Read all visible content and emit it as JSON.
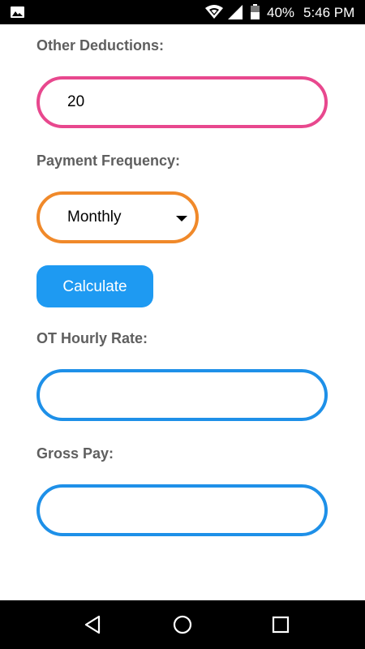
{
  "status_bar": {
    "battery": "40%",
    "time": "5:46 PM"
  },
  "form": {
    "other_deductions": {
      "label": "Other Deductions:",
      "value": "20"
    },
    "payment_frequency": {
      "label": "Payment Frequency:",
      "selected": "Monthly"
    },
    "calculate_label": "Calculate",
    "ot_hourly_rate": {
      "label": "OT Hourly Rate:",
      "value": ""
    },
    "gross_pay": {
      "label": "Gross Pay:",
      "value": ""
    }
  },
  "colors": {
    "deductions_border": "#e8488e",
    "frequency_border": "#f0892a",
    "output_border": "#1e90e8",
    "button_bg": "#1e9af2",
    "label_text": "#5f5f5f"
  },
  "icons": {
    "status_left": "image-gallery-icon",
    "wifi": "wifi-icon",
    "signal": "cell-signal-icon",
    "battery": "battery-icon",
    "nav_back": "back-triangle-icon",
    "nav_home": "home-circle-icon",
    "nav_recents": "recents-square-icon"
  }
}
